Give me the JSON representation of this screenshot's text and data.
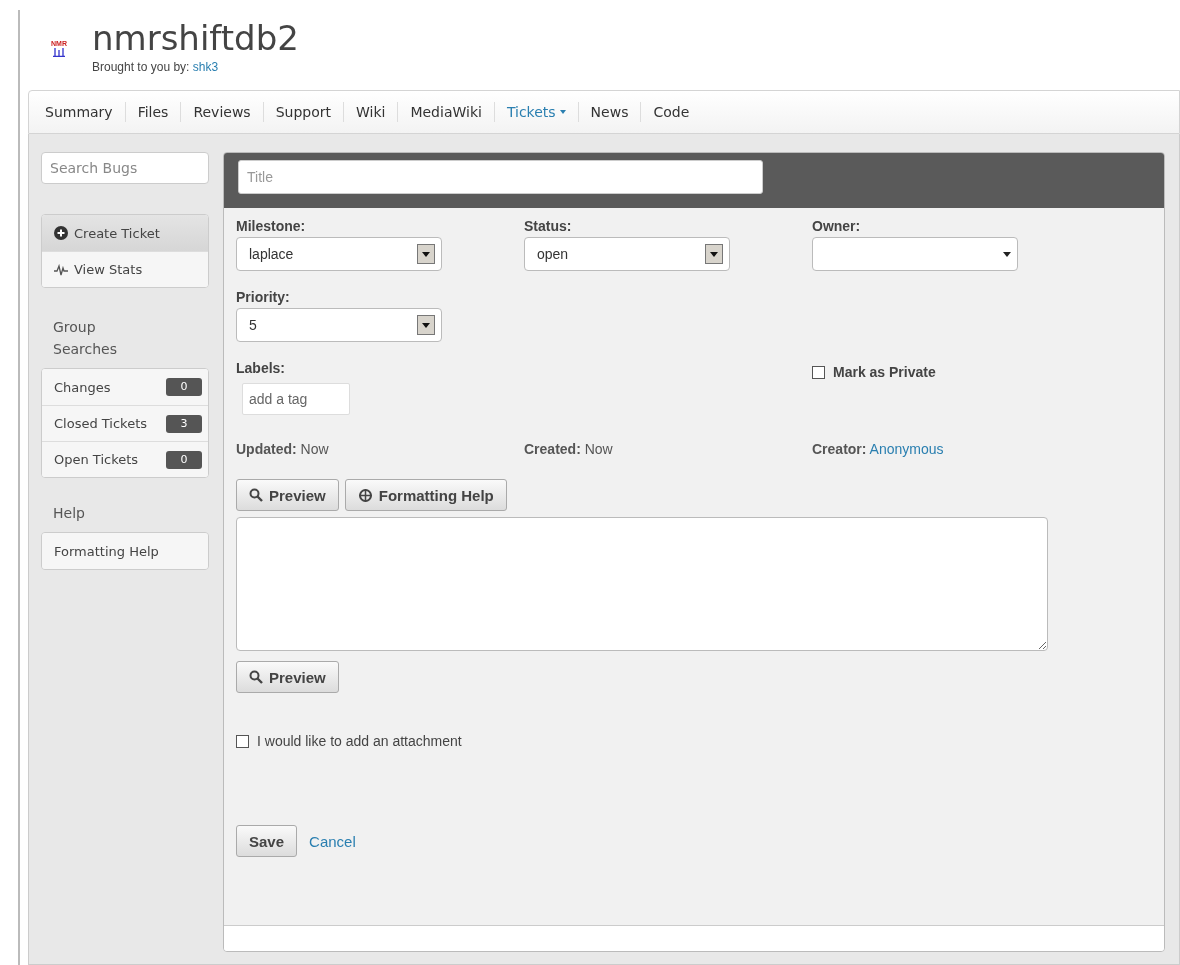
{
  "header": {
    "logo_text": "NMR",
    "title": "nmrshiftdb2",
    "byline": "Brought to you by:",
    "author": "shk3"
  },
  "nav": [
    {
      "label": "Summary",
      "selected": false,
      "has_menu": false
    },
    {
      "label": "Files",
      "selected": false,
      "has_menu": false
    },
    {
      "label": "Reviews",
      "selected": false,
      "has_menu": false
    },
    {
      "label": "Support",
      "selected": false,
      "has_menu": false
    },
    {
      "label": "Wiki",
      "selected": false,
      "has_menu": false
    },
    {
      "label": "MediaWiki",
      "selected": false,
      "has_menu": false
    },
    {
      "label": "Tickets",
      "selected": true,
      "has_menu": true
    },
    {
      "label": "News",
      "selected": false,
      "has_menu": false
    },
    {
      "label": "Code",
      "selected": false,
      "has_menu": false
    }
  ],
  "sidebar": {
    "search": {
      "placeholder": "Search Bugs"
    },
    "actions": [
      {
        "label": "Create Ticket",
        "kind": "create",
        "selected": true
      },
      {
        "label": "View Stats",
        "kind": "stats",
        "selected": false
      }
    ],
    "group_heading": "Group Searches",
    "groups": [
      {
        "label": "Changes",
        "count": "0"
      },
      {
        "label": "Closed Tickets",
        "count": "3"
      },
      {
        "label": "Open Tickets",
        "count": "0"
      }
    ],
    "help_heading": "Help",
    "help_items": [
      "Formatting Help"
    ]
  },
  "form": {
    "title_field": {
      "placeholder": "Title"
    },
    "selects": [
      {
        "label": "Milestone:",
        "value": "laplace",
        "kind": "classic"
      },
      {
        "label": "Status:",
        "value": "open",
        "kind": "classic"
      },
      {
        "label": "Owner:",
        "kind": "plain"
      },
      {
        "label": "Priority:",
        "value": "5",
        "kind": "classic"
      }
    ],
    "labels": {
      "label": "Labels:",
      "placeholder": "add a tag"
    },
    "private": {
      "label": "Mark as Private",
      "checked": false
    },
    "meta": [
      {
        "label": "Updated:",
        "value": "Now",
        "kind": "text"
      },
      {
        "label": "Created:",
        "value": "Now",
        "kind": "text"
      },
      {
        "label": "Creator:",
        "value": "Anonymous",
        "kind": "link"
      }
    ],
    "editor_buttons": [
      {
        "label": "Preview",
        "kind": "search"
      },
      {
        "label": "Formatting Help",
        "kind": "help"
      }
    ],
    "bottom_button": {
      "label": "Preview",
      "kind": "search"
    },
    "attachment": {
      "label": "I would like to add an attachment",
      "checked": false
    },
    "save": "Save",
    "cancel": "Cancel"
  }
}
